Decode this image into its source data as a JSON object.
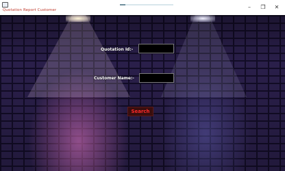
{
  "window": {
    "title": "Quotation Report Customer",
    "progress": 0.1,
    "controls": {
      "minimize": "–",
      "maximize": "❐",
      "close": "✕"
    }
  },
  "form": {
    "quotation_id_label": "Quotation Id:-",
    "quotation_id_value": "",
    "customer_name_label": "Customer Name:-",
    "customer_name_value": "",
    "search_button": "Search"
  },
  "colors": {
    "title_text": "#c0392b",
    "search_text": "#ff2a2a",
    "input_bg": "#000000"
  }
}
